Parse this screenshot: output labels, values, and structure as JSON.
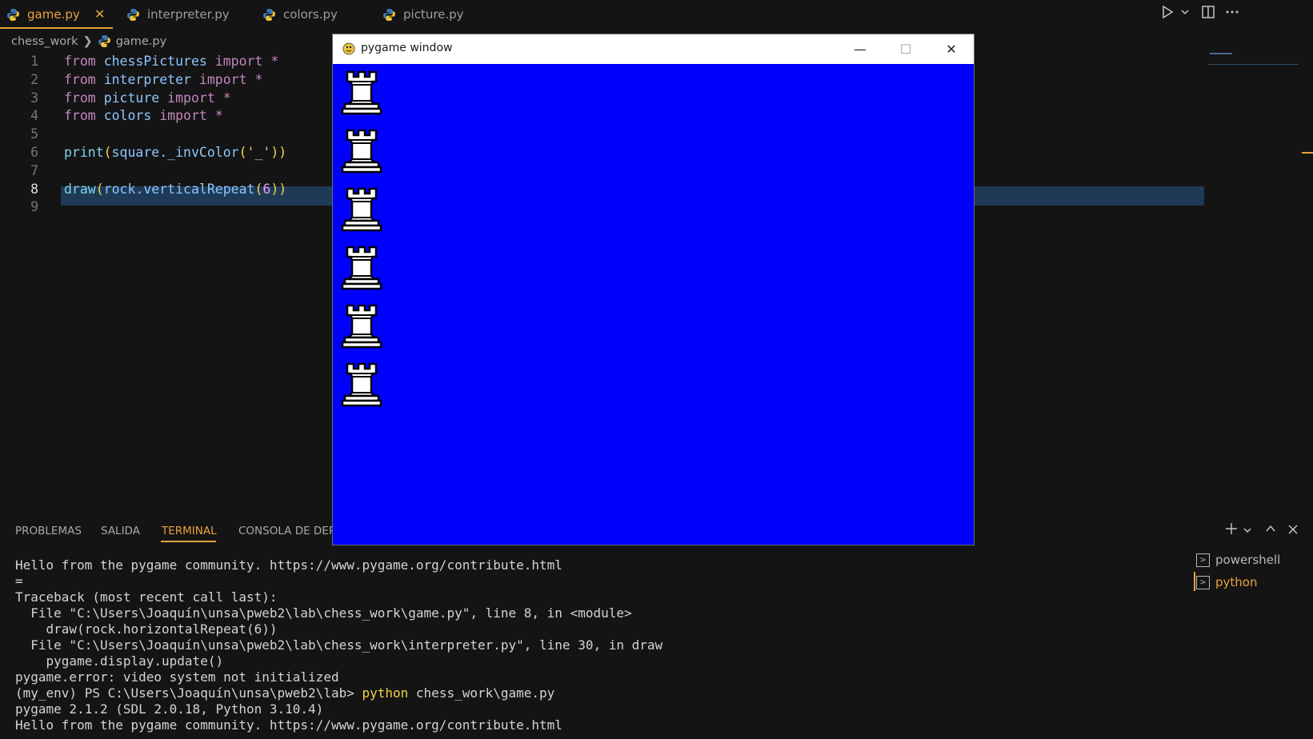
{
  "tabs": [
    {
      "label": "game.py",
      "active": true
    },
    {
      "label": "interpreter.py",
      "active": false
    },
    {
      "label": "colors.py",
      "active": false
    },
    {
      "label": "picture.py",
      "active": false
    }
  ],
  "tab_close_glyph": "✕",
  "breadcrumb": {
    "folder": "chess_work",
    "separator": "❯",
    "file": "game.py"
  },
  "editor": {
    "current_line": 8,
    "lines": [
      {
        "n": "1",
        "text": "from chessPictures import *"
      },
      {
        "n": "2",
        "text": "from interpreter import *"
      },
      {
        "n": "3",
        "text": "from picture import *"
      },
      {
        "n": "4",
        "text": "from colors import *"
      },
      {
        "n": "5",
        "text": ""
      },
      {
        "n": "6",
        "text": "print(square._invColor('_'))"
      },
      {
        "n": "7",
        "text": ""
      },
      {
        "n": "8",
        "text": "draw(rock.verticalRepeat(6))"
      },
      {
        "n": "9",
        "text": ""
      }
    ]
  },
  "panel": {
    "tabs": [
      "PROBLEMAS",
      "SALIDA",
      "TERMINAL",
      "CONSOLA DE DEPU"
    ],
    "active_tab": "TERMINAL"
  },
  "terminal": {
    "lines": [
      "Hello from the pygame community. https://www.pygame.org/contribute.html",
      "=",
      "Traceback (most recent call last):",
      "  File \"C:\\Users\\Joaquín\\unsa\\pweb2\\lab\\chess_work\\game.py\", line 8, in <module>",
      "    draw(rock.horizontalRepeat(6))",
      "  File \"C:\\Users\\Joaquín\\unsa\\pweb2\\lab\\chess_work\\interpreter.py\", line 30, in draw",
      "    pygame.display.update()",
      "pygame.error: video system not initialized",
      "(my_env) PS C:\\Users\\Joaquín\\unsa\\pweb2\\lab> ",
      "pygame 2.1.2 (SDL 2.0.18, Python 3.10.4)",
      "Hello from the pygame community. https://www.pygame.org/contribute.html"
    ],
    "prompt_command": "python",
    "prompt_arg": " chess_work\\game.py",
    "sessions": [
      {
        "label": "powershell",
        "active": false
      },
      {
        "label": "python",
        "active": true
      }
    ]
  },
  "pygame_window": {
    "title": "pygame window",
    "canvas_color": "#0000ff",
    "rook_count": 6,
    "buttons": {
      "minimize": "—",
      "maximize": "☐",
      "close": "✕"
    }
  },
  "colors": {
    "accent": "#e8a33d",
    "background": "#141414",
    "current_line": "#1f3a56"
  }
}
